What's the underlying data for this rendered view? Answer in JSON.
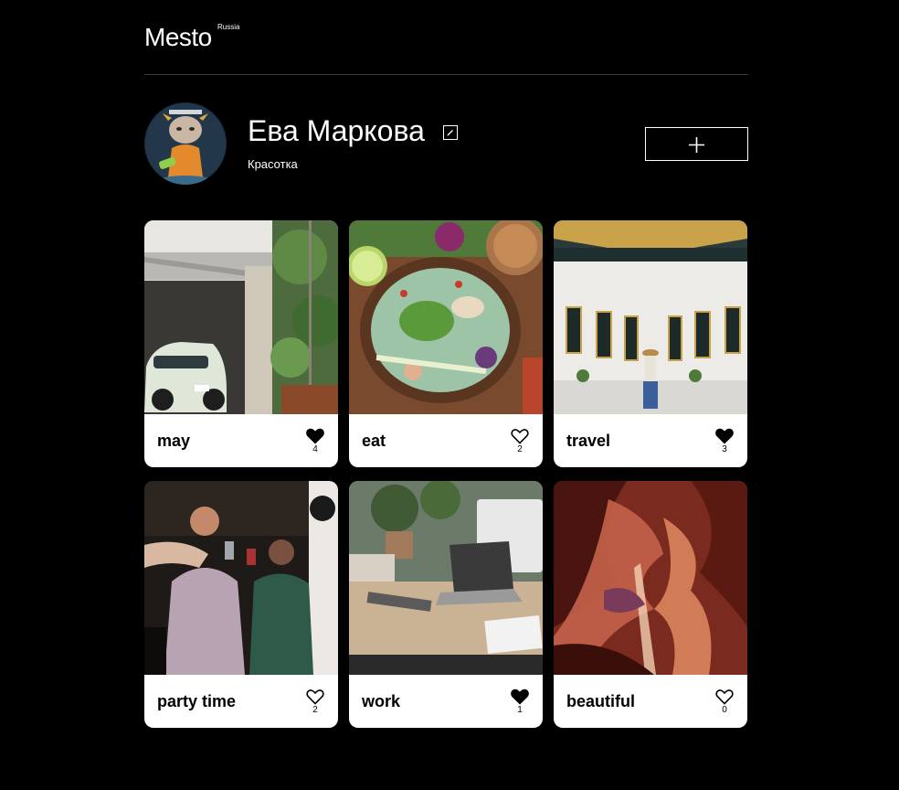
{
  "header": {
    "logo": "Mesto",
    "logo_sup": "Russia"
  },
  "profile": {
    "name": "Ева Маркова",
    "about": "Красотка",
    "edit_icon": "pencil-icon",
    "add_icon": "plus-icon"
  },
  "cards": [
    {
      "title": "may",
      "likes": "4",
      "liked": true,
      "scene": "street-car"
    },
    {
      "title": "eat",
      "likes": "2",
      "liked": false,
      "scene": "food-bowl"
    },
    {
      "title": "travel",
      "likes": "3",
      "liked": true,
      "scene": "temple"
    },
    {
      "title": "party time",
      "likes": "2",
      "liked": false,
      "scene": "party"
    },
    {
      "title": "work",
      "likes": "1",
      "liked": true,
      "scene": "desk"
    },
    {
      "title": "beautiful",
      "likes": "0",
      "liked": false,
      "scene": "canyon"
    }
  ]
}
